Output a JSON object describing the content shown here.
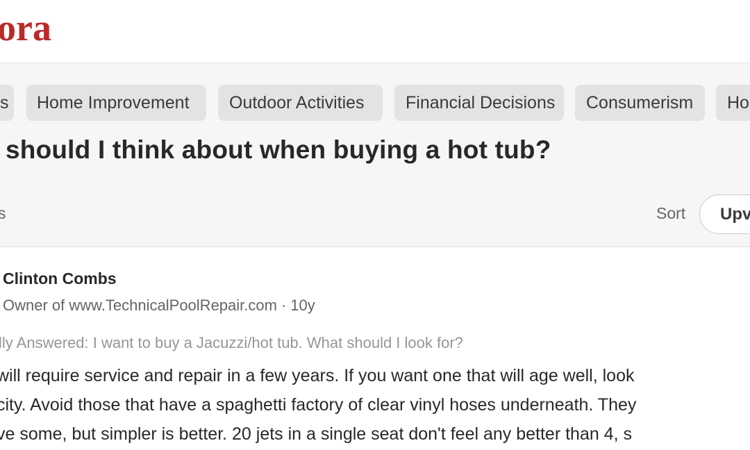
{
  "header": {
    "logo_text": "ora"
  },
  "topics": [
    {
      "label": "s"
    },
    {
      "label": "Home Improvement"
    },
    {
      "label": "Outdoor Activities"
    },
    {
      "label": "Financial Decisions"
    },
    {
      "label": "Consumerism"
    },
    {
      "label": "Ho"
    }
  ],
  "question": {
    "title": " should I think about when buying a hot tub?",
    "answers_count": "s",
    "sort_label": "Sort",
    "sort_value": "Upv"
  },
  "answer": {
    "author_name": "Clinton Combs",
    "author_credential": "Owner of www.TechnicalPoolRepair.com",
    "timestamp": "10y",
    "separator": "·",
    "originally_answered": "lly Answered: I want to buy a Jacuzzi/hot tub. What should I look for?",
    "lines": [
      "will require service and repair in a few years. If you want one that will age well, look",
      "city. Avoid those that have a spaghetti factory of clear vinyl hoses underneath. They",
      "ve some, but simpler is better. 20 jets in a single seat don't feel any better than 4, s"
    ]
  },
  "colors": {
    "brand": "#b92b27",
    "background_question": "#f6f6f6",
    "topic_bg": "#e3e3e3"
  }
}
